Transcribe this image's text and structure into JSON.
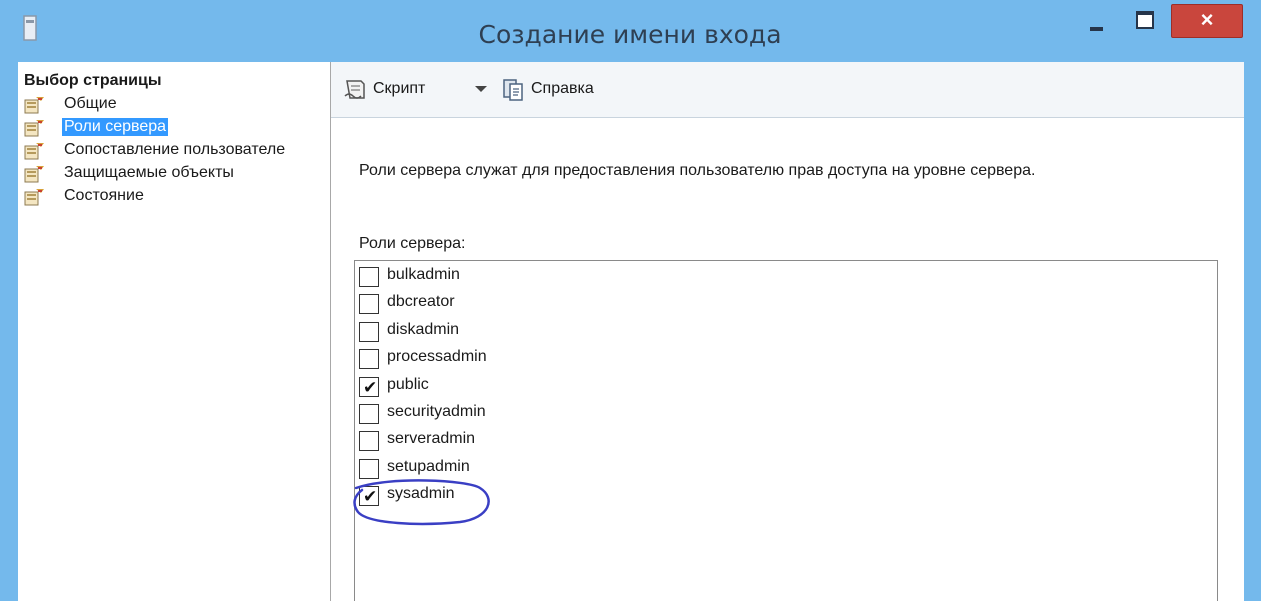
{
  "window": {
    "title": "Создание имени входа",
    "close_glyph": "×",
    "accent_color": "#74b9ec",
    "close_color": "#c9463d"
  },
  "sidebar": {
    "header": "Выбор страницы",
    "items": [
      {
        "label": "Общие",
        "icon": "page-icon"
      },
      {
        "label": "Роли сервера",
        "icon": "page-icon",
        "selected": true
      },
      {
        "label": "Сопоставление пользователе",
        "icon": "page-icon"
      },
      {
        "label": "Защищаемые объекты",
        "icon": "page-icon"
      },
      {
        "label": "Состояние",
        "icon": "page-icon"
      }
    ],
    "selection_color": "#3399ff"
  },
  "toolbar": {
    "script_label": "Скрипт",
    "help_label": "Справка",
    "script_icon": "script-icon",
    "help_icon": "help-icon"
  },
  "main": {
    "description": "Роли сервера служат для предоставления пользователю прав доступа на уровне сервера.",
    "roles_label": "Роли сервера:",
    "check_glyph": "✔",
    "roles": [
      {
        "name": "bulkadmin",
        "checked": false
      },
      {
        "name": "dbcreator",
        "checked": false
      },
      {
        "name": "diskadmin",
        "checked": false
      },
      {
        "name": "processadmin",
        "checked": false
      },
      {
        "name": "public",
        "checked": true
      },
      {
        "name": "securityadmin",
        "checked": false
      },
      {
        "name": "serveradmin",
        "checked": false
      },
      {
        "name": "setupadmin",
        "checked": false
      },
      {
        "name": "sysadmin",
        "checked": true,
        "highlighted": true
      }
    ]
  }
}
